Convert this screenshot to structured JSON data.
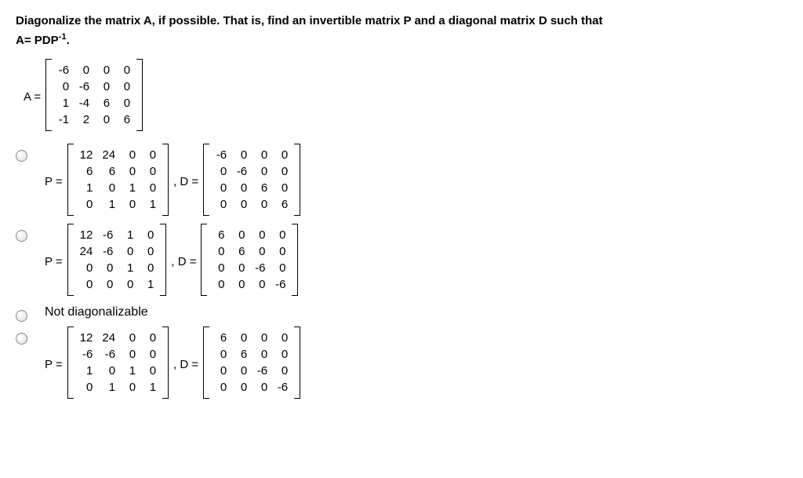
{
  "question": {
    "line1": "Diagonalize the matrix A, if possible. That is, find an invertible matrix P and a diagonal matrix D such that",
    "line2_a": "A= PDP",
    "line2_exp": "-1",
    "line2_dot": "."
  },
  "label_A_eq": "A =",
  "label_P_eq": "P =",
  "label_D_eq": ", D =",
  "A": [
    [
      "-6",
      "0",
      "0",
      "0"
    ],
    [
      "0",
      "-6",
      "0",
      "0"
    ],
    [
      "1",
      "-4",
      "6",
      "0"
    ],
    [
      "-1",
      "2",
      "0",
      "6"
    ]
  ],
  "opt1": {
    "P": [
      [
        "12",
        "24",
        "0",
        "0"
      ],
      [
        "6",
        "6",
        "0",
        "0"
      ],
      [
        "1",
        "0",
        "1",
        "0"
      ],
      [
        "0",
        "1",
        "0",
        "1"
      ]
    ],
    "D": [
      [
        "-6",
        "0",
        "0",
        "0"
      ],
      [
        "0",
        "-6",
        "0",
        "0"
      ],
      [
        "0",
        "0",
        "6",
        "0"
      ],
      [
        "0",
        "0",
        "0",
        "6"
      ]
    ]
  },
  "opt2": {
    "P": [
      [
        "12",
        "-6",
        "1",
        "0"
      ],
      [
        "24",
        "-6",
        "0",
        "0"
      ],
      [
        "0",
        "0",
        "1",
        "0"
      ],
      [
        "0",
        "0",
        "0",
        "1"
      ]
    ],
    "D": [
      [
        "6",
        "0",
        "0",
        "0"
      ],
      [
        "0",
        "6",
        "0",
        "0"
      ],
      [
        "0",
        "0",
        "-6",
        "0"
      ],
      [
        "0",
        "0",
        "0",
        "-6"
      ]
    ]
  },
  "opt3_text": "Not diagonalizable",
  "opt4": {
    "P": [
      [
        "12",
        "24",
        "0",
        "0"
      ],
      [
        "-6",
        "-6",
        "0",
        "0"
      ],
      [
        "1",
        "0",
        "1",
        "0"
      ],
      [
        "0",
        "1",
        "0",
        "1"
      ]
    ],
    "D": [
      [
        "6",
        "0",
        "0",
        "0"
      ],
      [
        "0",
        "6",
        "0",
        "0"
      ],
      [
        "0",
        "0",
        "-6",
        "0"
      ],
      [
        "0",
        "0",
        "0",
        "-6"
      ]
    ]
  }
}
